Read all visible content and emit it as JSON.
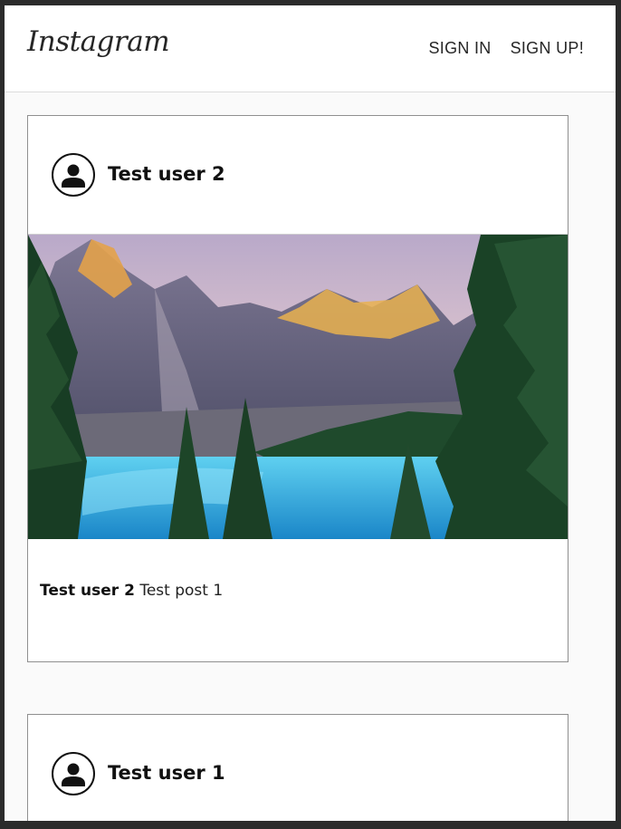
{
  "header": {
    "logo_text": "Instagram",
    "nav": {
      "sign_in": "SIGN IN",
      "sign_up": "SIGN UP!"
    }
  },
  "posts": [
    {
      "username": "Test user 2",
      "image_icon": "landscape-photo",
      "caption_user": "Test user 2",
      "caption_text": "Test post 1"
    },
    {
      "username": "Test user 1"
    }
  ],
  "colors": {
    "background": "#fafafa",
    "card": "#ffffff",
    "border": "#8f8f8f",
    "text": "#262626",
    "lake": "#2fb3e0"
  }
}
